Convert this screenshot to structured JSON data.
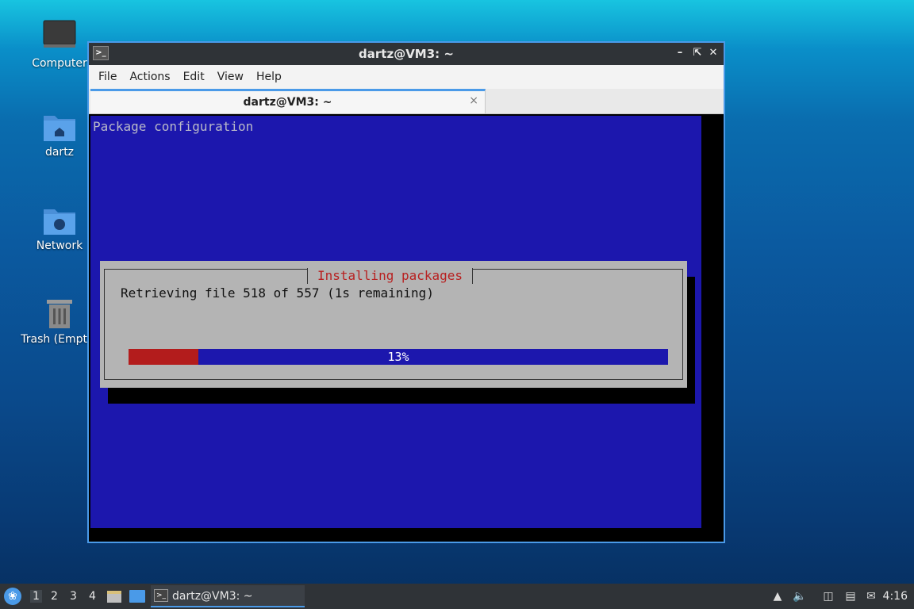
{
  "desktop": {
    "icons": [
      {
        "label": "Computer"
      },
      {
        "label": "dartz"
      },
      {
        "label": "Network"
      },
      {
        "label": "Trash (Empty)"
      }
    ]
  },
  "window": {
    "title": "dartz@VM3: ~",
    "menu": [
      "File",
      "Actions",
      "Edit",
      "View",
      "Help"
    ],
    "tab_label": "dartz@VM3: ~",
    "tab_close": "×"
  },
  "terminal": {
    "header": "Package configuration",
    "dialog": {
      "title": "Installing packages",
      "message": "Retrieving file 518 of 557 (1s remaining)",
      "progress_percent": 13,
      "progress_label": "13%"
    }
  },
  "taskbar": {
    "workspaces": [
      "1",
      "2",
      "3",
      "4"
    ],
    "active_workspace": "1",
    "task_label": "dartz@VM3: ~",
    "clock": "4:16"
  },
  "colors": {
    "accent": "#4a9ae8",
    "dialog_title": "#b82020",
    "progress_fill": "#b31c1c",
    "terminal_bg": "#1c17ad"
  }
}
